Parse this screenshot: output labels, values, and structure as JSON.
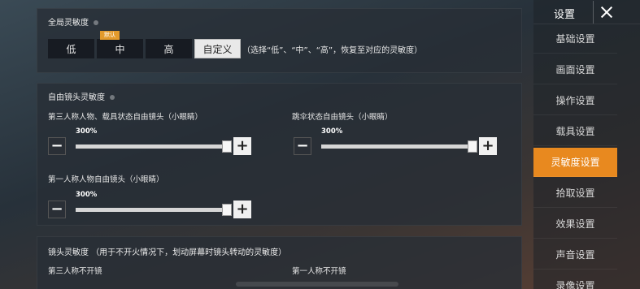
{
  "global_sensitivity": {
    "title": "全局灵敏度",
    "options": [
      "低",
      "中",
      "高",
      "自定义"
    ],
    "default_badge": "默认",
    "selected": "自定义",
    "note": "（选择“低”、“中”、“高”，恢复至对应的灵敏度）"
  },
  "free_camera": {
    "title": "自由镜头灵敏度",
    "third_person_label": "第三人称人物、载具状态自由镜头（小眼睛）",
    "third_person_value": "300%",
    "third_person_level": 1.0,
    "parachute_label": "跳伞状态自由镜头（小眼睛）",
    "parachute_value": "300%",
    "parachute_level": 1.0,
    "first_person_label": "第一人称人物自由镜头（小眼睛）",
    "first_person_value": "300%",
    "first_person_level": 1.0
  },
  "camera_sensitivity": {
    "title": "镜头灵敏度",
    "note": "（用于不开火情况下，划动屏幕时镜头转动的灵敏度）",
    "third_person_no_scope": "第三人称不开镜",
    "first_person_no_scope": "第一人称不开镜"
  },
  "sidebar": {
    "title": "设置",
    "items": [
      "基础设置",
      "画面设置",
      "操作设置",
      "载具设置",
      "灵敏度设置",
      "拾取设置",
      "效果设置",
      "声音设置",
      "录像设置"
    ],
    "active_index": 4
  },
  "colors": {
    "accent": "#e8891f",
    "badge": "#e39a2c"
  }
}
